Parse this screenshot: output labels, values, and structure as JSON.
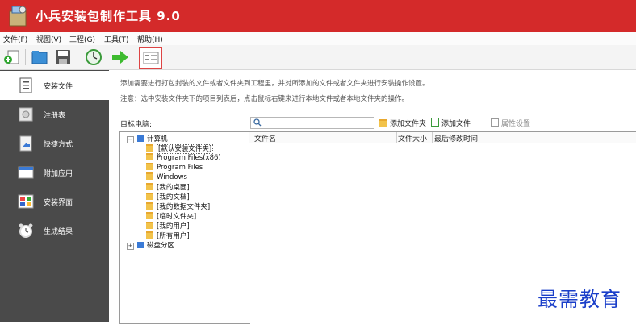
{
  "app": {
    "title": "小兵安装包制作工具 9.0",
    "brand_color": "#d42a2a"
  },
  "menu": [
    "文件(F)",
    "视图(V)",
    "工程(G)",
    "工具(T)",
    "帮助(H)"
  ],
  "toolbar": {
    "icons": [
      "add-file-icon",
      "open-folder-icon",
      "save-icon",
      "compile-icon",
      "run-arrow-icon",
      "properties-icon"
    ]
  },
  "sidebar": {
    "items": [
      {
        "label": "安装文件",
        "icon": "install-files-icon",
        "active": true
      },
      {
        "label": "注册表",
        "icon": "registry-icon",
        "active": false
      },
      {
        "label": "快捷方式",
        "icon": "shortcut-icon",
        "active": false
      },
      {
        "label": "附加应用",
        "icon": "extra-app-icon",
        "active": false
      },
      {
        "label": "安装界面",
        "icon": "install-ui-icon",
        "active": false
      },
      {
        "label": "生成结果",
        "icon": "build-result-icon",
        "active": false
      }
    ]
  },
  "main": {
    "hint1": "添加需要进行打包封装的文件或者文件夹到工程里，并对所添加的文件或者文件夹进行安装操作设置。",
    "hint2": "注意：选中安装文件夹下的项目列表后，点击鼠标右键来进行本地文件或者本地文件夹的操作。",
    "target_label": "目标电脑:",
    "search_placeholder": "",
    "add_folder": "添加文件夹",
    "add_file": "添加文件",
    "properties": "属性设置"
  },
  "tree": {
    "root": "计算机",
    "children": [
      "[默认安装文件夹]",
      "Program Files(x86)",
      "Program Files",
      "Windows",
      "[我的桌面]",
      "[我的文档]",
      "[我的数据文件夹]",
      "[临时文件夹]",
      "[我的用户]",
      "[所有用户]"
    ],
    "disk": "磁盘分区"
  },
  "filelist": {
    "columns": [
      "文件名",
      "文件大小",
      "最后修改时间"
    ]
  },
  "watermark": "最需教育"
}
